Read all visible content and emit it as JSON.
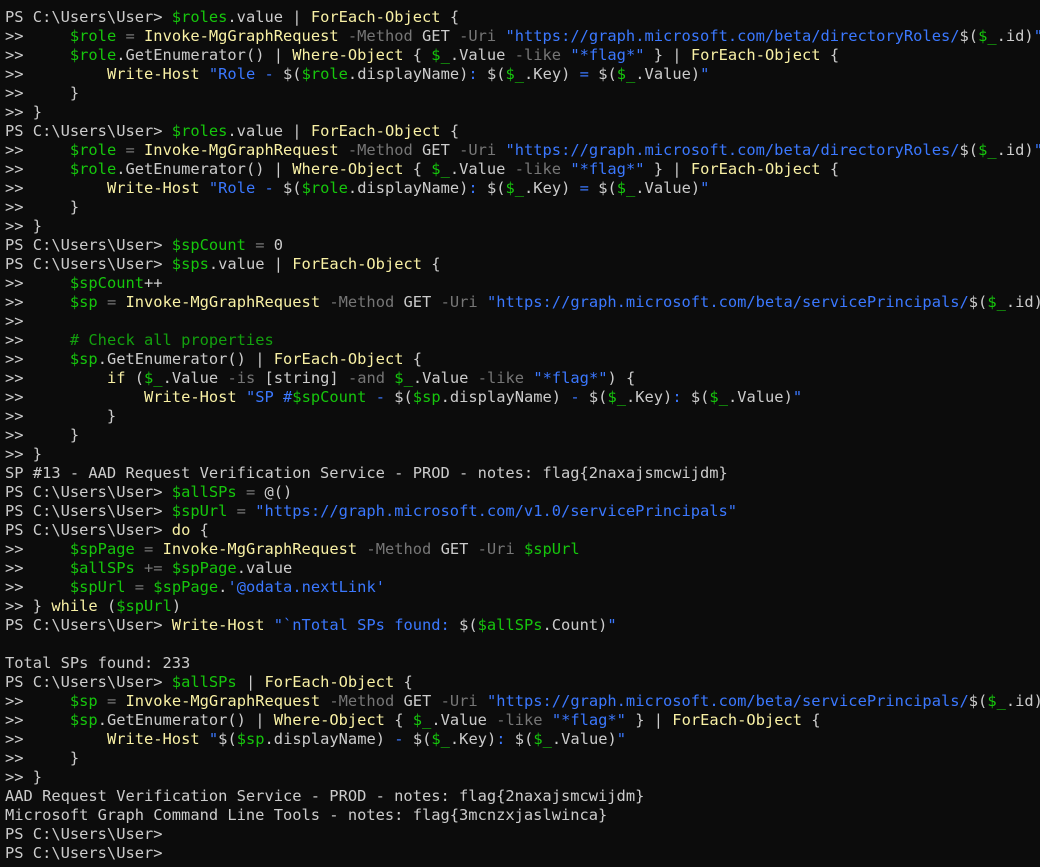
{
  "colors": {
    "background": "#0c0c0c",
    "default": "#cccccc",
    "variable": "#16c60c",
    "command": "#f9f1a5",
    "parameter": "#767676",
    "string": "#3b78ff",
    "comment": "#13a10e",
    "operator": "#767676"
  },
  "lines": [
    [
      [
        "d",
        "PS C:\\Users\\User> "
      ],
      [
        "v",
        "$roles"
      ],
      [
        "d",
        ".value | "
      ],
      [
        "c",
        "ForEach-Object"
      ],
      [
        "d",
        " {"
      ]
    ],
    [
      [
        "d",
        ">>     "
      ],
      [
        "v",
        "$role"
      ],
      [
        "o",
        " = "
      ],
      [
        "c",
        "Invoke-MgGraphRequest"
      ],
      [
        "p",
        " -Method"
      ],
      [
        "d",
        " GET "
      ],
      [
        "p",
        "-Uri"
      ],
      [
        "d",
        " "
      ],
      [
        "s",
        "\"https://graph.microsoft.com/beta/directoryRoles/"
      ],
      [
        "d",
        "$("
      ],
      [
        "v",
        "$_"
      ],
      [
        "d",
        ".id)"
      ],
      [
        "s",
        "\""
      ]
    ],
    [
      [
        "d",
        ">>     "
      ],
      [
        "v",
        "$role"
      ],
      [
        "d",
        ".GetEnumerator() | "
      ],
      [
        "c",
        "Where-Object"
      ],
      [
        "d",
        " { "
      ],
      [
        "v",
        "$_"
      ],
      [
        "d",
        ".Value "
      ],
      [
        "p",
        "-like"
      ],
      [
        "d",
        " "
      ],
      [
        "s",
        "\"*flag*\""
      ],
      [
        "d",
        " } | "
      ],
      [
        "c",
        "ForEach-Object"
      ],
      [
        "d",
        " {"
      ]
    ],
    [
      [
        "d",
        ">>         "
      ],
      [
        "c",
        "Write-Host"
      ],
      [
        "d",
        " "
      ],
      [
        "s",
        "\"Role - "
      ],
      [
        "d",
        "$("
      ],
      [
        "v",
        "$role"
      ],
      [
        "d",
        ".displayName)"
      ],
      [
        "s",
        ": "
      ],
      [
        "d",
        "$("
      ],
      [
        "v",
        "$_"
      ],
      [
        "d",
        ".Key)"
      ],
      [
        "s",
        " = "
      ],
      [
        "d",
        "$("
      ],
      [
        "v",
        "$_"
      ],
      [
        "d",
        ".Value)"
      ],
      [
        "s",
        "\""
      ]
    ],
    [
      [
        "d",
        ">>     }"
      ]
    ],
    [
      [
        "d",
        ">> }"
      ]
    ],
    [
      [
        "d",
        "PS C:\\Users\\User> "
      ],
      [
        "v",
        "$roles"
      ],
      [
        "d",
        ".value | "
      ],
      [
        "c",
        "ForEach-Object"
      ],
      [
        "d",
        " {"
      ]
    ],
    [
      [
        "d",
        ">>     "
      ],
      [
        "v",
        "$role"
      ],
      [
        "o",
        " = "
      ],
      [
        "c",
        "Invoke-MgGraphRequest"
      ],
      [
        "p",
        " -Method"
      ],
      [
        "d",
        " GET "
      ],
      [
        "p",
        "-Uri"
      ],
      [
        "d",
        " "
      ],
      [
        "s",
        "\"https://graph.microsoft.com/beta/directoryRoles/"
      ],
      [
        "d",
        "$("
      ],
      [
        "v",
        "$_"
      ],
      [
        "d",
        ".id)"
      ],
      [
        "s",
        "\""
      ]
    ],
    [
      [
        "d",
        ">>     "
      ],
      [
        "v",
        "$role"
      ],
      [
        "d",
        ".GetEnumerator() | "
      ],
      [
        "c",
        "Where-Object"
      ],
      [
        "d",
        " { "
      ],
      [
        "v",
        "$_"
      ],
      [
        "d",
        ".Value "
      ],
      [
        "p",
        "-like"
      ],
      [
        "d",
        " "
      ],
      [
        "s",
        "\"*flag*\""
      ],
      [
        "d",
        " } | "
      ],
      [
        "c",
        "ForEach-Object"
      ],
      [
        "d",
        " {"
      ]
    ],
    [
      [
        "d",
        ">>         "
      ],
      [
        "c",
        "Write-Host"
      ],
      [
        "d",
        " "
      ],
      [
        "s",
        "\"Role - "
      ],
      [
        "d",
        "$("
      ],
      [
        "v",
        "$role"
      ],
      [
        "d",
        ".displayName)"
      ],
      [
        "s",
        ": "
      ],
      [
        "d",
        "$("
      ],
      [
        "v",
        "$_"
      ],
      [
        "d",
        ".Key)"
      ],
      [
        "s",
        " = "
      ],
      [
        "d",
        "$("
      ],
      [
        "v",
        "$_"
      ],
      [
        "d",
        ".Value)"
      ],
      [
        "s",
        "\""
      ]
    ],
    [
      [
        "d",
        ">>     }"
      ]
    ],
    [
      [
        "d",
        ">> }"
      ]
    ],
    [
      [
        "d",
        "PS C:\\Users\\User> "
      ],
      [
        "v",
        "$spCount"
      ],
      [
        "o",
        " = "
      ],
      [
        "d",
        "0"
      ]
    ],
    [
      [
        "d",
        "PS C:\\Users\\User> "
      ],
      [
        "v",
        "$sps"
      ],
      [
        "d",
        ".value | "
      ],
      [
        "c",
        "ForEach-Object"
      ],
      [
        "d",
        " {"
      ]
    ],
    [
      [
        "d",
        ">>     "
      ],
      [
        "v",
        "$spCount"
      ],
      [
        "d",
        "++"
      ]
    ],
    [
      [
        "d",
        ">>     "
      ],
      [
        "v",
        "$sp"
      ],
      [
        "o",
        " = "
      ],
      [
        "c",
        "Invoke-MgGraphRequest"
      ],
      [
        "p",
        " -Method"
      ],
      [
        "d",
        " GET "
      ],
      [
        "p",
        "-Uri"
      ],
      [
        "d",
        " "
      ],
      [
        "s",
        "\"https://graph.microsoft.com/beta/servicePrincipals/"
      ],
      [
        "d",
        "$("
      ],
      [
        "v",
        "$_"
      ],
      [
        "d",
        ".id)"
      ],
      [
        "s",
        "\""
      ]
    ],
    [
      [
        "d",
        ">>"
      ]
    ],
    [
      [
        "d",
        ">>     "
      ],
      [
        "cm",
        "# Check all properties"
      ]
    ],
    [
      [
        "d",
        ">>     "
      ],
      [
        "v",
        "$sp"
      ],
      [
        "d",
        ".GetEnumerator() | "
      ],
      [
        "c",
        "ForEach-Object"
      ],
      [
        "d",
        " {"
      ]
    ],
    [
      [
        "d",
        ">>         "
      ],
      [
        "k",
        "if"
      ],
      [
        "d",
        " ("
      ],
      [
        "v",
        "$_"
      ],
      [
        "d",
        ".Value "
      ],
      [
        "p",
        "-is"
      ],
      [
        "d",
        " [string] "
      ],
      [
        "p",
        "-and"
      ],
      [
        "d",
        " "
      ],
      [
        "v",
        "$_"
      ],
      [
        "d",
        ".Value "
      ],
      [
        "p",
        "-like"
      ],
      [
        "d",
        " "
      ],
      [
        "s",
        "\"*flag*\""
      ],
      [
        "d",
        ") {"
      ]
    ],
    [
      [
        "d",
        ">>             "
      ],
      [
        "c",
        "Write-Host"
      ],
      [
        "d",
        " "
      ],
      [
        "s",
        "\"SP #"
      ],
      [
        "v",
        "$spCount"
      ],
      [
        "s",
        " - "
      ],
      [
        "d",
        "$("
      ],
      [
        "v",
        "$sp"
      ],
      [
        "d",
        ".displayName)"
      ],
      [
        "s",
        " - "
      ],
      [
        "d",
        "$("
      ],
      [
        "v",
        "$_"
      ],
      [
        "d",
        ".Key)"
      ],
      [
        "s",
        ": "
      ],
      [
        "d",
        "$("
      ],
      [
        "v",
        "$_"
      ],
      [
        "d",
        ".Value)"
      ],
      [
        "s",
        "\""
      ]
    ],
    [
      [
        "d",
        ">>         }"
      ]
    ],
    [
      [
        "d",
        ">>     }"
      ]
    ],
    [
      [
        "d",
        ">> }"
      ]
    ],
    [
      [
        "d",
        "SP #13 - AAD Request Verification Service - PROD - notes: flag{2naxajsmcwijdm}"
      ]
    ],
    [
      [
        "d",
        "PS C:\\Users\\User> "
      ],
      [
        "v",
        "$allSPs"
      ],
      [
        "o",
        " = "
      ],
      [
        "d",
        "@()"
      ]
    ],
    [
      [
        "d",
        "PS C:\\Users\\User> "
      ],
      [
        "v",
        "$spUrl"
      ],
      [
        "o",
        " = "
      ],
      [
        "s",
        "\"https://graph.microsoft.com/v1.0/servicePrincipals\""
      ]
    ],
    [
      [
        "d",
        "PS C:\\Users\\User> "
      ],
      [
        "k",
        "do"
      ],
      [
        "d",
        " {"
      ]
    ],
    [
      [
        "d",
        ">>     "
      ],
      [
        "v",
        "$spPage"
      ],
      [
        "o",
        " = "
      ],
      [
        "c",
        "Invoke-MgGraphRequest"
      ],
      [
        "p",
        " -Method"
      ],
      [
        "d",
        " GET "
      ],
      [
        "p",
        "-Uri"
      ],
      [
        "d",
        " "
      ],
      [
        "v",
        "$spUrl"
      ]
    ],
    [
      [
        "d",
        ">>     "
      ],
      [
        "v",
        "$allSPs"
      ],
      [
        "o",
        " += "
      ],
      [
        "v",
        "$spPage"
      ],
      [
        "d",
        ".value"
      ]
    ],
    [
      [
        "d",
        ">>     "
      ],
      [
        "v",
        "$spUrl"
      ],
      [
        "o",
        " = "
      ],
      [
        "v",
        "$spPage"
      ],
      [
        "d",
        "."
      ],
      [
        "s",
        "'@odata.nextLink'"
      ]
    ],
    [
      [
        "d",
        ">> } "
      ],
      [
        "k",
        "while"
      ],
      [
        "d",
        " ("
      ],
      [
        "v",
        "$spUrl"
      ],
      [
        "d",
        ")"
      ]
    ],
    [
      [
        "d",
        "PS C:\\Users\\User> "
      ],
      [
        "c",
        "Write-Host"
      ],
      [
        "d",
        " "
      ],
      [
        "s",
        "\"`nTotal SPs found: "
      ],
      [
        "d",
        "$("
      ],
      [
        "v",
        "$allSPs"
      ],
      [
        "d",
        ".Count)"
      ],
      [
        "s",
        "\""
      ]
    ],
    [
      [
        "d",
        ""
      ]
    ],
    [
      [
        "d",
        "Total SPs found: 233"
      ]
    ],
    [
      [
        "d",
        "PS C:\\Users\\User> "
      ],
      [
        "v",
        "$allSPs"
      ],
      [
        "d",
        " | "
      ],
      [
        "c",
        "ForEach-Object"
      ],
      [
        "d",
        " {"
      ]
    ],
    [
      [
        "d",
        ">>     "
      ],
      [
        "v",
        "$sp"
      ],
      [
        "o",
        " = "
      ],
      [
        "c",
        "Invoke-MgGraphRequest"
      ],
      [
        "p",
        " -Method"
      ],
      [
        "d",
        " GET "
      ],
      [
        "p",
        "-Uri"
      ],
      [
        "d",
        " "
      ],
      [
        "s",
        "\"https://graph.microsoft.com/beta/servicePrincipals/"
      ],
      [
        "d",
        "$("
      ],
      [
        "v",
        "$_"
      ],
      [
        "d",
        ".id)"
      ],
      [
        "s",
        "\""
      ]
    ],
    [
      [
        "d",
        ">>     "
      ],
      [
        "v",
        "$sp"
      ],
      [
        "d",
        ".GetEnumerator() | "
      ],
      [
        "c",
        "Where-Object"
      ],
      [
        "d",
        " { "
      ],
      [
        "v",
        "$_"
      ],
      [
        "d",
        ".Value "
      ],
      [
        "p",
        "-like"
      ],
      [
        "d",
        " "
      ],
      [
        "s",
        "\"*flag*\""
      ],
      [
        "d",
        " } | "
      ],
      [
        "c",
        "ForEach-Object"
      ],
      [
        "d",
        " {"
      ]
    ],
    [
      [
        "d",
        ">>         "
      ],
      [
        "c",
        "Write-Host"
      ],
      [
        "d",
        " "
      ],
      [
        "s",
        "\""
      ],
      [
        "d",
        "$("
      ],
      [
        "v",
        "$sp"
      ],
      [
        "d",
        ".displayName)"
      ],
      [
        "s",
        " - "
      ],
      [
        "d",
        "$("
      ],
      [
        "v",
        "$_"
      ],
      [
        "d",
        ".Key)"
      ],
      [
        "s",
        ": "
      ],
      [
        "d",
        "$("
      ],
      [
        "v",
        "$_"
      ],
      [
        "d",
        ".Value)"
      ],
      [
        "s",
        "\""
      ]
    ],
    [
      [
        "d",
        ">>     }"
      ]
    ],
    [
      [
        "d",
        ">> }"
      ]
    ],
    [
      [
        "d",
        "AAD Request Verification Service - PROD - notes: flag{2naxajsmcwijdm}"
      ]
    ],
    [
      [
        "d",
        "Microsoft Graph Command Line Tools - notes: flag{3mcnzxjaslwinca}"
      ]
    ],
    [
      [
        "d",
        "PS C:\\Users\\User>"
      ]
    ],
    [
      [
        "d",
        "PS C:\\Users\\User>"
      ]
    ]
  ]
}
